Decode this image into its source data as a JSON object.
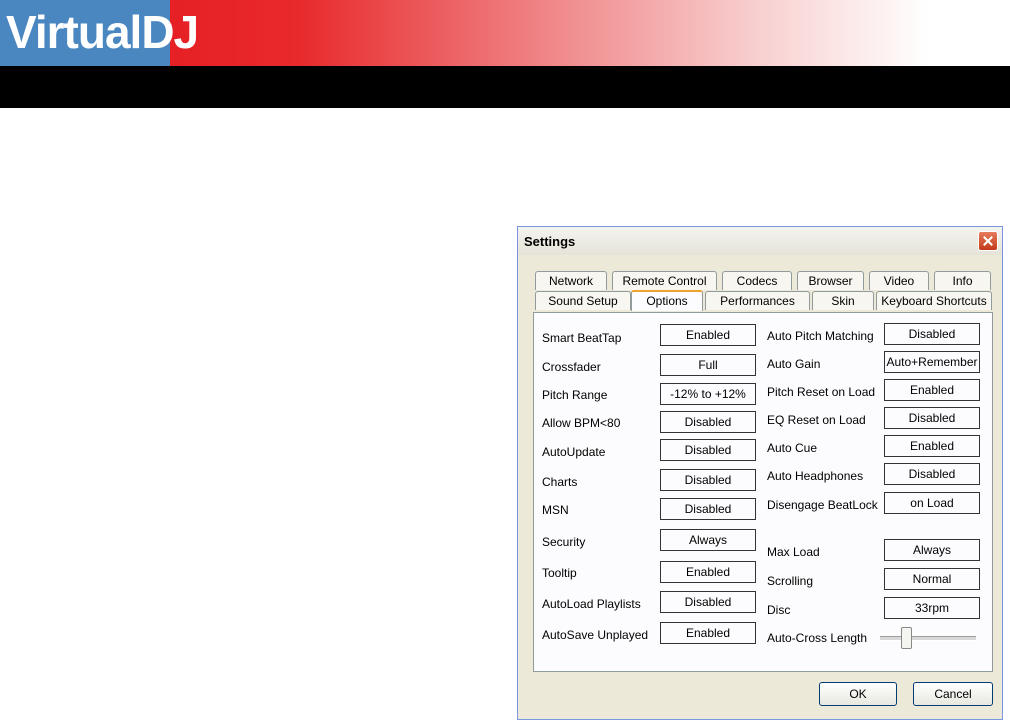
{
  "banner": {
    "logo_part1": "Virtual",
    "logo_part2": "DJ"
  },
  "dialog": {
    "title": "Settings",
    "tabs_row1": [
      "Network",
      "Remote Control",
      "Codecs",
      "Browser",
      "Video",
      "Info"
    ],
    "tabs_row2": [
      "Sound Setup",
      "Options",
      "Performances",
      "Skin",
      "Keyboard Shortcuts"
    ],
    "active_tab": "Options",
    "left_settings": [
      {
        "label": "Smart BeatTap",
        "value": "Enabled"
      },
      {
        "label": "Crossfader",
        "value": "Full"
      },
      {
        "label": "Pitch Range",
        "value": "-12% to +12%"
      },
      {
        "label": "Allow BPM<80",
        "value": "Disabled"
      },
      {
        "label": "AutoUpdate",
        "value": "Disabled"
      },
      {
        "label": "Charts",
        "value": "Disabled"
      },
      {
        "label": "MSN",
        "value": "Disabled"
      },
      {
        "label": "Security",
        "value": "Always"
      },
      {
        "label": "Tooltip",
        "value": "Enabled"
      },
      {
        "label": "AutoLoad Playlists",
        "value": "Disabled"
      },
      {
        "label": "AutoSave Unplayed",
        "value": "Enabled"
      }
    ],
    "right_settings": [
      {
        "label": "Auto Pitch Matching",
        "value": "Disabled"
      },
      {
        "label": "Auto Gain",
        "value": "Auto+Remember"
      },
      {
        "label": "Pitch Reset on Load",
        "value": "Enabled"
      },
      {
        "label": "EQ Reset on Load",
        "value": "Disabled"
      },
      {
        "label": "Auto Cue",
        "value": "Enabled"
      },
      {
        "label": "Auto Headphones",
        "value": "Disabled"
      },
      {
        "label": "Disengage BeatLock",
        "value": "on Load"
      },
      {
        "label": "Max Load",
        "value": "Always"
      },
      {
        "label": "Scrolling",
        "value": "Normal"
      },
      {
        "label": "Disc",
        "value": "33rpm"
      }
    ],
    "autocross": {
      "label": "Auto-Cross Length",
      "value_fraction": 0.25
    },
    "ok_label": "OK",
    "cancel_label": "Cancel"
  }
}
